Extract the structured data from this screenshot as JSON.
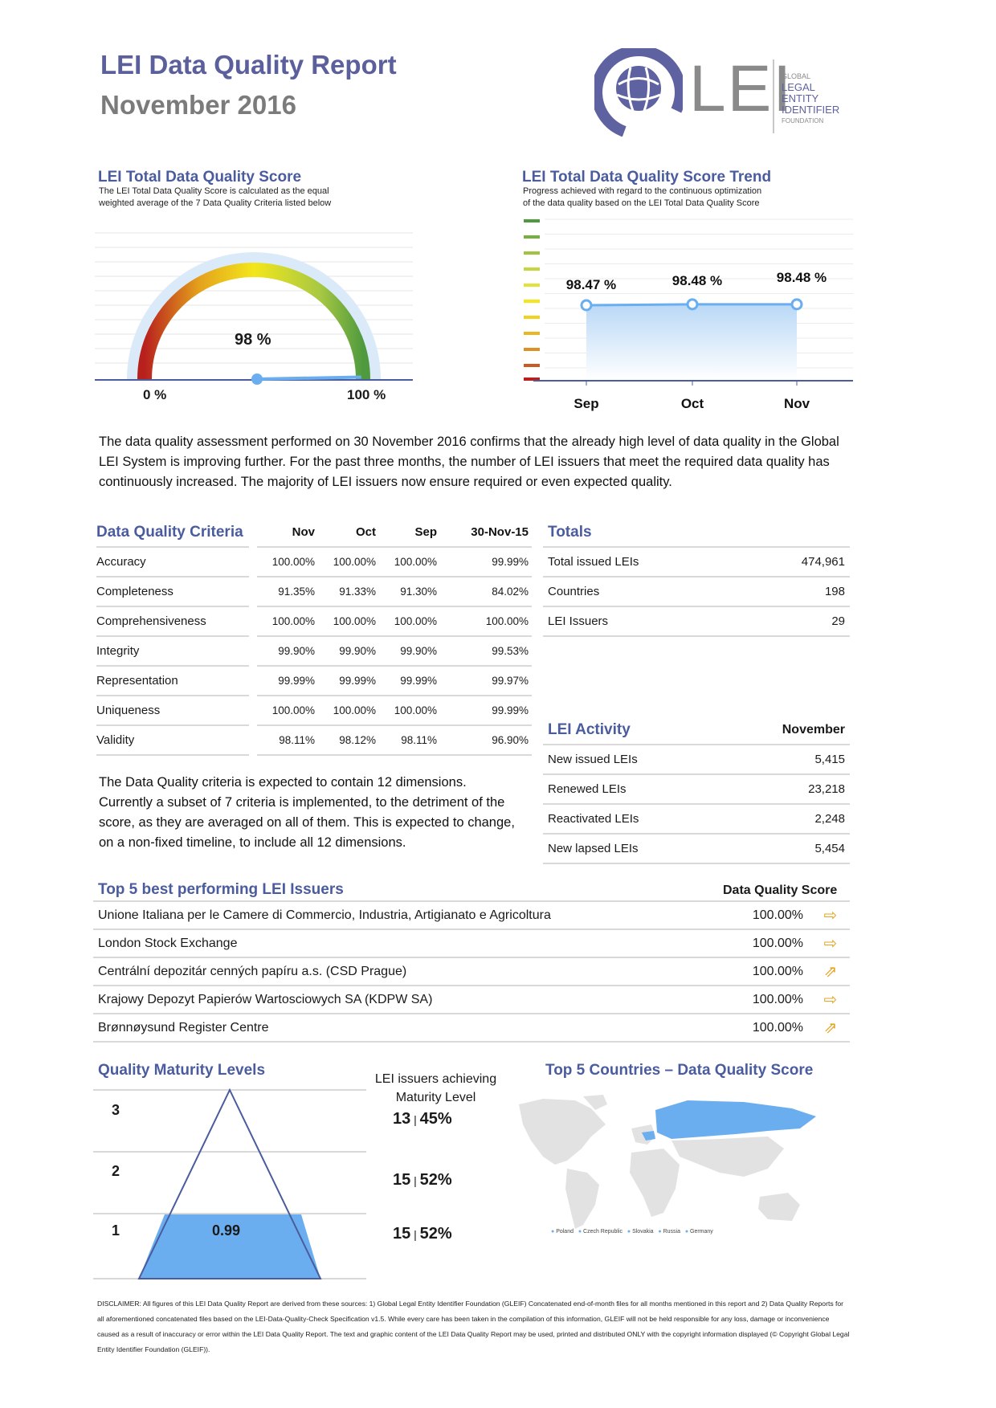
{
  "header": {
    "title": "LEI Data Quality Report",
    "subtitle": "November 2016",
    "logo_text": "LEI",
    "logo_tag": [
      "GLOBAL",
      "LEGAL",
      "ENTITY",
      "IDENTIFIER",
      "FOUNDATION"
    ]
  },
  "gauge": {
    "title": "LEI Total Data Quality Score",
    "desc_1": "The LEI Total Data Quality Score is calculated as the equal",
    "desc_2": "weighted average of the 7 Data Quality Criteria listed below",
    "value_label": "98 %",
    "value": 98,
    "min_label": "0 %",
    "max_label": "100 %"
  },
  "trend": {
    "title": "LEI Total Data Quality Score Trend",
    "desc_1": "Progress achieved with regard to the continuous optimization",
    "desc_2": "of the data quality based on the LEI Total Data Quality Score"
  },
  "chart_data": {
    "type": "area",
    "categories": [
      "Sep",
      "Oct",
      "Nov"
    ],
    "values": [
      98.47,
      98.48,
      98.48
    ],
    "data_labels": [
      "98.47 %",
      "98.48 %",
      "98.48 %"
    ]
  },
  "intro": "The data quality assessment performed on 30 November 2016 confirms that the already high level of data quality in the Global LEI System is improving further. For the past three months, the number of LEI issuers that meet the required data quality has continuously increased. The majority of LEI issuers now ensure required or even expected quality.",
  "criteria": {
    "title": "Data Quality Criteria",
    "columns": [
      "Nov",
      "Oct",
      "Sep",
      "30-Nov-15"
    ],
    "rows": [
      {
        "name": "Accuracy",
        "values": [
          "100.00%",
          "100.00%",
          "100.00%",
          "99.99%"
        ]
      },
      {
        "name": "Completeness",
        "values": [
          "91.35%",
          "91.33%",
          "91.30%",
          "84.02%"
        ]
      },
      {
        "name": "Comprehensiveness",
        "values": [
          "100.00%",
          "100.00%",
          "100.00%",
          "100.00%"
        ]
      },
      {
        "name": "Integrity",
        "values": [
          "99.90%",
          "99.90%",
          "99.90%",
          "99.53%"
        ]
      },
      {
        "name": "Representation",
        "values": [
          "99.99%",
          "99.99%",
          "99.99%",
          "99.97%"
        ]
      },
      {
        "name": "Uniqueness",
        "values": [
          "100.00%",
          "100.00%",
          "100.00%",
          "99.99%"
        ]
      },
      {
        "name": "Validity",
        "values": [
          "98.11%",
          "98.12%",
          "98.11%",
          "96.90%"
        ]
      }
    ],
    "note": "The Data Quality criteria is expected to contain 12 dimensions. Currently a subset of 7 criteria is implemented, to the detriment of the score, as they are averaged on all of them. This is expected to change, on a non-fixed timeline, to include all 12 dimensions."
  },
  "totals": {
    "title": "Totals",
    "rows": [
      {
        "label": "Total issued LEIs",
        "value": "474,961"
      },
      {
        "label": "Countries",
        "value": "198"
      },
      {
        "label": "LEI Issuers",
        "value": "29"
      }
    ]
  },
  "activity": {
    "title": "LEI Activity",
    "column": "November",
    "rows": [
      {
        "label": "New issued LEIs",
        "value": "5,415"
      },
      {
        "label": "Renewed LEIs",
        "value": "23,218"
      },
      {
        "label": "Reactivated LEIs",
        "value": "2,248"
      },
      {
        "label": "New lapsed LEIs",
        "value": "5,454"
      }
    ]
  },
  "top5": {
    "title": "Top 5 best performing LEI Issuers",
    "column": "Data Quality Score",
    "rows": [
      {
        "name": "Unione Italiana per le Camere di Commercio, Industria, Artigianato e Agricoltura",
        "score": "100.00%",
        "arrow": "right-arrow-icon"
      },
      {
        "name": "London Stock Exchange",
        "score": "100.00%",
        "arrow": "right-arrow-icon"
      },
      {
        "name": "Centrální depozitár cenných papíru a.s. (CSD Prague)",
        "score": "100.00%",
        "arrow": "up-right-arrow-icon"
      },
      {
        "name": "Krajowy Depozyt Papierów Wartosciowych SA (KDPW SA)",
        "score": "100.00%",
        "arrow": "right-arrow-icon"
      },
      {
        "name": "Brønnøysund Register Centre",
        "score": "100.00%",
        "arrow": "up-right-arrow-icon"
      }
    ]
  },
  "maturity": {
    "title": "Quality Maturity Levels",
    "col_title_1": "LEI issuers achieving",
    "col_title_2": "Maturity Level",
    "fill_label": "0.99",
    "levels": [
      {
        "level": "3",
        "count": "13",
        "pct": "45%"
      },
      {
        "level": "2",
        "count": "15",
        "pct": "52%"
      },
      {
        "level": "1",
        "count": "15",
        "pct": "52%"
      }
    ]
  },
  "countries": {
    "title": "Top 5 Countries – Data Quality Score",
    "legend": [
      "Poland",
      "Czech Republic",
      "Slovakia",
      "Russia",
      "Germany"
    ]
  },
  "disclaimer": "DISCLAIMER: All figures of this LEI Data Quality Report are derived from these sources: 1) Global Legal Entity Identifier Foundation (GLEIF) Concatenated end-of-month files for all months mentioned in this report and 2) Data Quality Reports for all aforementioned concatenated files based on the LEI-Data-Quality-Check Specification v1.5. While every care has been taken in the compilation of this information, GLEIF will not be held responsible for any loss, damage or inconvenience caused as a result of inaccuracy or error within the LEI Data Quality Report. The text and graphic content of the LEI Data Quality Report may be used, printed and distributed ONLY with the copyright information displayed (© Copyright Global Legal Entity Identifier Foundation (GLEIF))."
}
